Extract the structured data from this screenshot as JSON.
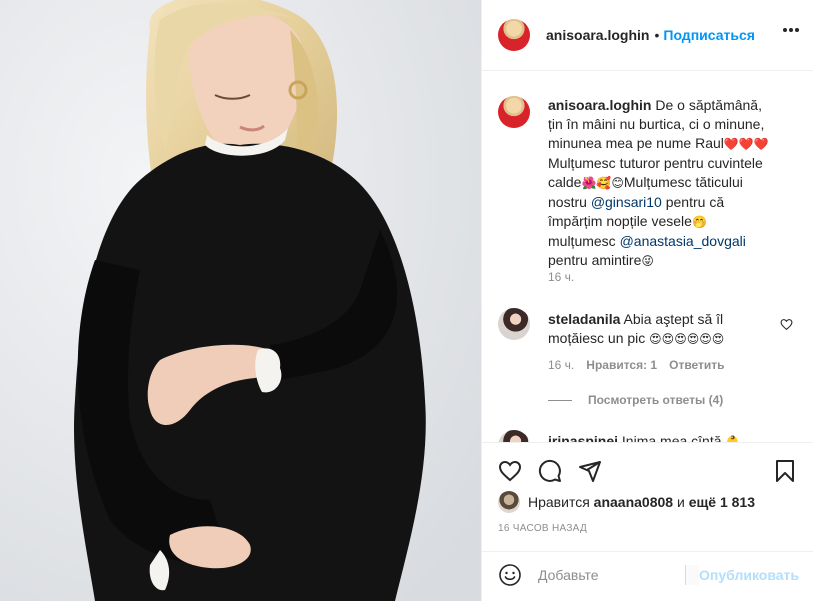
{
  "post": {
    "author": "anisoara.loghin",
    "separator": "•",
    "follow_label": "Подписаться",
    "more_icon": "more-horizontal-icon"
  },
  "caption": {
    "author": "anisoara.loghin",
    "text_1": "De o săptămână, țin în mâini nu burtica, ci o minune, minunea mea pe nume Raul",
    "emoji_1": "❤️❤️❤️",
    "text_2": "Mulțumesc tuturor pentru cuvintele calde",
    "emoji_2": "🌺🥰😊",
    "text_3": "Mulțumesc tăticului nostru ",
    "mention_1": "@ginsari10",
    "text_4": " pentru că împărțim nopțile vesele",
    "emoji_3": "🤭",
    "text_5": " mulțumesc ",
    "mention_2": "@anastasia_dovgali",
    "text_6": " pentru amintire",
    "emoji_4": "😜",
    "time": "16 ч."
  },
  "comment_1": {
    "author": "steladanila",
    "text": "Abia aştept să îl moțăiesc un pic",
    "emoji": "😍😍😍😍😍😍",
    "time": "16 ч.",
    "likes": "Нравится: 1",
    "reply": "Ответить"
  },
  "view_replies": "Посмотреть ответы (4)",
  "comment_2": {
    "author": "irinaspinei",
    "text": "Inima mea cîntă",
    "emoji": "👶"
  },
  "likes": {
    "prefix": "Нравится",
    "user": "anaana0808",
    "joiner": "и",
    "others": "ещё 1 813"
  },
  "time_ago": "16 ЧАСОВ НАЗАД",
  "compose": {
    "placeholder": "Добавьте",
    "post_label": "Опубликовать"
  },
  "colors": {
    "accent": "#0095f6",
    "link": "#00376b",
    "muted": "#8e8e8e",
    "disabled_post": "#b2dffc"
  }
}
